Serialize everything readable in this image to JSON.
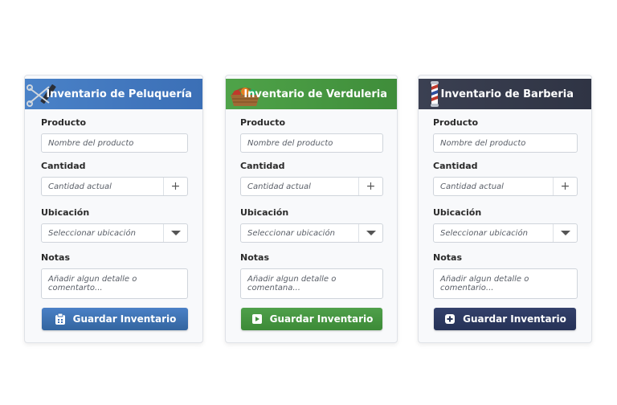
{
  "cards": [
    {
      "title": "Inventario de Peluquería",
      "icon": "scissors-comb-icon",
      "producto_label": "Producto",
      "producto_placeholder": "Nombre del producto",
      "cantidad_label": "Cantidad",
      "cantidad_placeholder": "Cantidad actual",
      "ubicacion_label": "Ubicación",
      "ubicacion_value": "Seleccionar ubicación",
      "notas_label": "Notas",
      "notas_placeholder": "Añadir algun detalle o comentarto...",
      "save_label": "Guardar Inventario",
      "accent": "#3b6fb6"
    },
    {
      "title": "Inventario de Verduleria",
      "icon": "vegetable-basket-icon",
      "producto_label": "Producto",
      "producto_placeholder": "Nombre del producto",
      "cantidad_label": "Cantidad",
      "cantidad_placeholder": "Cantidad actual",
      "ubicacion_label": "Ubicación",
      "ubicacion_value": "Seleccionar ubicación",
      "notas_label": "Notas",
      "notas_placeholder": "Añadir algun detalle o comentana...",
      "save_label": "Guardar Inventario",
      "accent": "#3f8d3a"
    },
    {
      "title": "Inventario de Barberia",
      "icon": "barber-pole-icon",
      "producto_label": "Producto",
      "producto_placeholder": "Nombre del producto",
      "cantidad_label": "Cantidad",
      "cantidad_placeholder": "Cantidad actual",
      "ubicacion_label": "Ubicación",
      "ubicacion_value": "Seleccionar ubicación",
      "notas_label": "Notas",
      "notas_placeholder": "Añadir algun detalle o comentario...",
      "save_label": "Guardar Inventario",
      "accent": "#263257"
    }
  ]
}
